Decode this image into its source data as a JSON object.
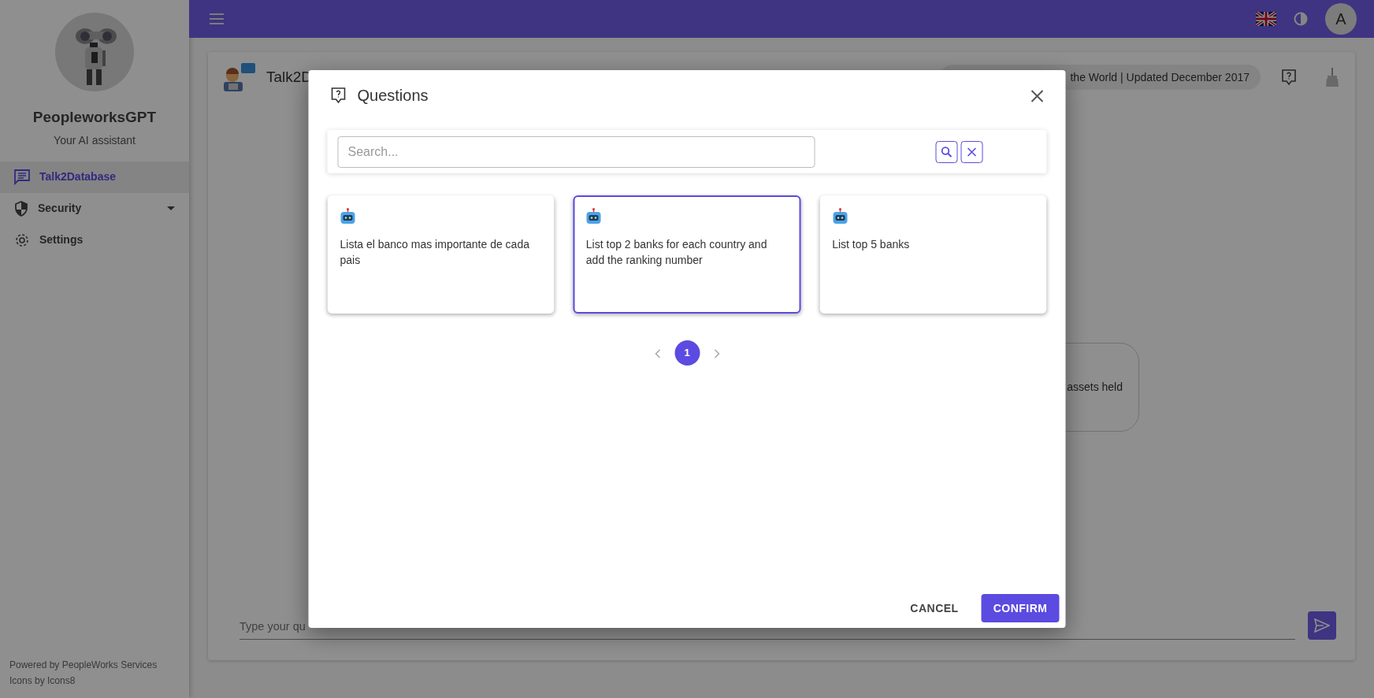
{
  "sidebar": {
    "app_name": "PeopleworksGPT",
    "subtitle": "Your AI assistant",
    "items": [
      {
        "label": "Talk2Database",
        "selected": true,
        "expandable": false
      },
      {
        "label": "Security",
        "selected": false,
        "expandable": true
      },
      {
        "label": "Settings",
        "selected": false,
        "expandable": false
      }
    ],
    "footer": [
      "Powered by PeopleWorks Services",
      "Icons by Icons8"
    ]
  },
  "topbar": {
    "avatar_letter": "A"
  },
  "page": {
    "title": "Talk2D",
    "dataset_chip": "the World | Updated December 2017",
    "message": "assets held",
    "input_placeholder": "Type your qu"
  },
  "dialog": {
    "title": "Questions",
    "search_placeholder": "Search...",
    "questions": [
      {
        "text": "Lista el banco mas importante de cada pais",
        "selected": false
      },
      {
        "text": "List top 2 banks for each country and add the ranking number",
        "selected": true
      },
      {
        "text": "List top 5 banks",
        "selected": false
      }
    ],
    "pages": [
      {
        "label": "1",
        "selected": true
      }
    ],
    "buttons": [
      {
        "label": "CANCEL",
        "kind": "text"
      },
      {
        "label": "CONFIRM",
        "kind": "primary"
      }
    ]
  }
}
